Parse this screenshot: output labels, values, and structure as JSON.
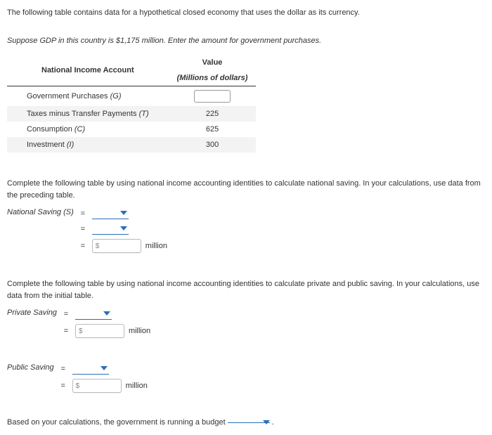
{
  "intro": "The following table contains data for a hypothetical closed economy that uses the dollar as its currency.",
  "prompt": "Suppose GDP in this country is $1,175 million. Enter the amount for government purchases.",
  "table": {
    "header_left": "National Income Account",
    "header_right_top": "Value",
    "header_right_sub": "(Millions of dollars)",
    "rows": [
      {
        "label": "Government Purchases",
        "sym": "(G)",
        "value": ""
      },
      {
        "label": "Taxes minus Transfer Payments",
        "sym": "(T)",
        "value": "225"
      },
      {
        "label": "Consumption",
        "sym": "(C)",
        "value": "625"
      },
      {
        "label": "Investment",
        "sym": "(I)",
        "value": "300"
      }
    ]
  },
  "section2": "Complete the following table by using national income accounting identities to calculate national saving. In your calculations, use data from the preceding table.",
  "national_saving_label": "National Saving (S)",
  "section3": "Complete the following table by using national income accounting identities to calculate private and public saving. In your calculations, use data from the initial table.",
  "private_saving_label": "Private Saving",
  "public_saving_label": "Public Saving",
  "dollar": "$",
  "unit": "million",
  "eq": "=",
  "footer_pre": "Based on your calculations, the government is running a budget",
  "footer_post": "."
}
